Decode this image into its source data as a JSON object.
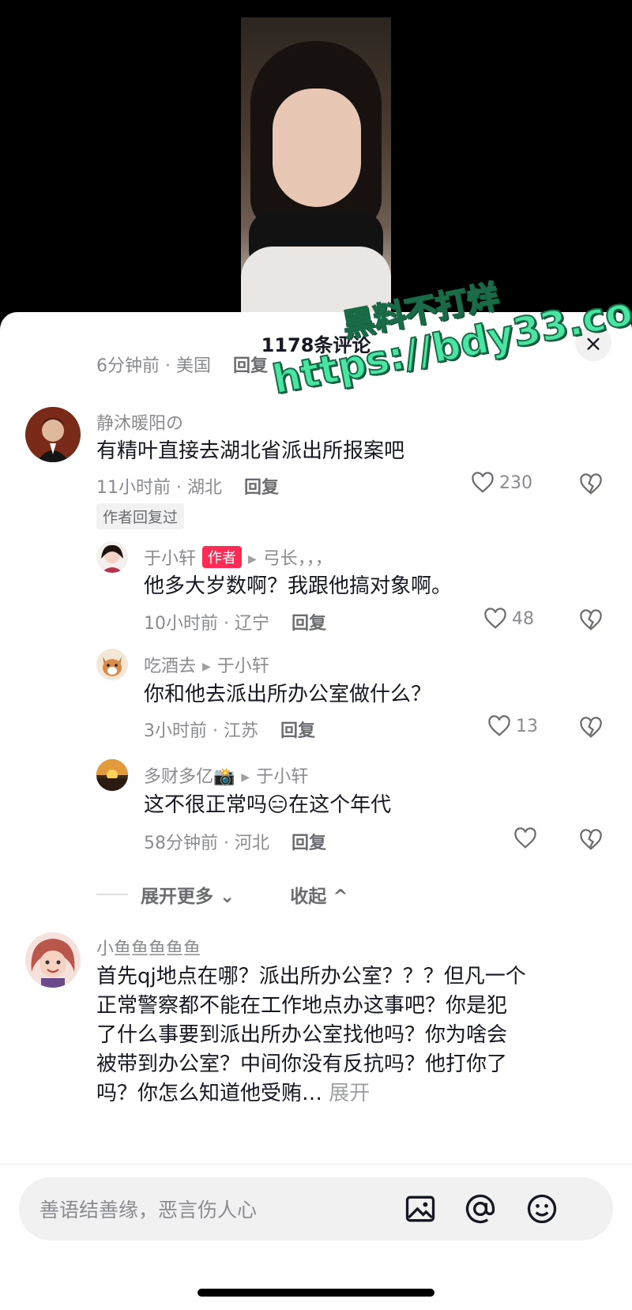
{
  "sheet": {
    "title": "1178条评论",
    "close_label": "×"
  },
  "prev_comment": {
    "meta": "6分钟前 · 美国",
    "reply": "回复"
  },
  "comments": [
    {
      "username": "静沐暖阳の",
      "text": "有精叶直接去湖北省派出所报案吧",
      "meta": "11小时前 · 湖北",
      "reply": "回复",
      "likes": "230",
      "author_replied": "作者回复过"
    }
  ],
  "replies": [
    {
      "username": "于小轩",
      "badge": "作者",
      "reply_to": "弓长，，，",
      "text": "他多大岁数啊？我跟他搞对象啊。",
      "meta": "10小时前 · 辽宁",
      "reply": "回复",
      "likes": "48"
    },
    {
      "username": "吃酒去",
      "reply_to": "于小轩",
      "text": "你和他去派出所办公室做什么？",
      "meta": "3小时前 · 江苏",
      "reply": "回复",
      "likes": "13"
    },
    {
      "username": "多财多亿📸",
      "reply_to": "于小轩",
      "text_before": "这不很正常吗",
      "emoji": "😑",
      "text_after": "在这个年代",
      "meta": "58分钟前 · 河北",
      "reply": "回复",
      "likes": ""
    }
  ],
  "expand": {
    "more": "展开更多",
    "collapse": "收起"
  },
  "last_comment": {
    "username": "小鱼鱼鱼鱼鱼",
    "line1": "首先qj地点在哪？派出所办公室？？？但凡一个",
    "line2": "正常警察都不能在工作地点办这事吧？你是犯",
    "line3": "了什么事要到派出所办公室找他吗？你为啥会",
    "line4": "被带到办公室？中间你没有反抗吗？他打你了",
    "line5": "吗？你怎么知道他受贿…",
    "more": "展开"
  },
  "watermark": {
    "line1": "黑料不打烊",
    "line2": "https://bdy33.co"
  },
  "input": {
    "placeholder": "善语结善缘，恶言伤人心"
  }
}
